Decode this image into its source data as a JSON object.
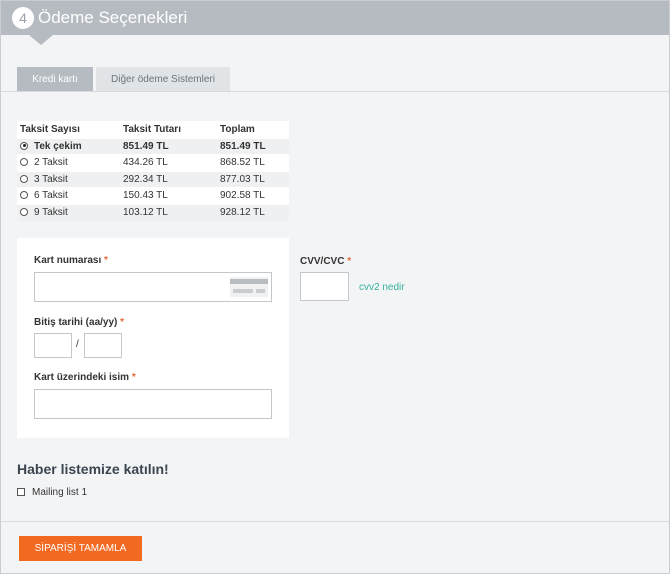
{
  "header": {
    "step": "4",
    "title": "Ödeme Seçenekleri"
  },
  "tabs": [
    {
      "label": "Kredi kartı"
    },
    {
      "label": "Diğer ödeme Sistemleri"
    }
  ],
  "installments": {
    "headers": [
      "Taksit Sayısı",
      "Taksit Tutarı",
      "Toplam"
    ],
    "rows": [
      {
        "label": "Tek çekim",
        "amount": "851.49 TL",
        "total": "851.49 TL"
      },
      {
        "label": "2 Taksit",
        "amount": "434.26 TL",
        "total": "868.52 TL"
      },
      {
        "label": "3 Taksit",
        "amount": "292.34 TL",
        "total": "877.03 TL"
      },
      {
        "label": "6 Taksit",
        "amount": "150.43 TL",
        "total": "902.58 TL"
      },
      {
        "label": "9 Taksit",
        "amount": "103.12 TL",
        "total": "928.12 TL"
      }
    ]
  },
  "card_form": {
    "card_number_label": "Kart numarası",
    "expiry_label": "Bitiş tarihi (aa/yy)",
    "expiry_separator": "/",
    "name_label": "Kart üzerindeki isim",
    "required_mark": "*",
    "cvv_label": "CVV/CVC",
    "cvv_help": "cvv2 nedir"
  },
  "newsletter": {
    "title": "Haber listemize katılın!",
    "option": "Mailing list 1"
  },
  "submit": {
    "label": "SİPARİŞİ TAMAMLA"
  }
}
